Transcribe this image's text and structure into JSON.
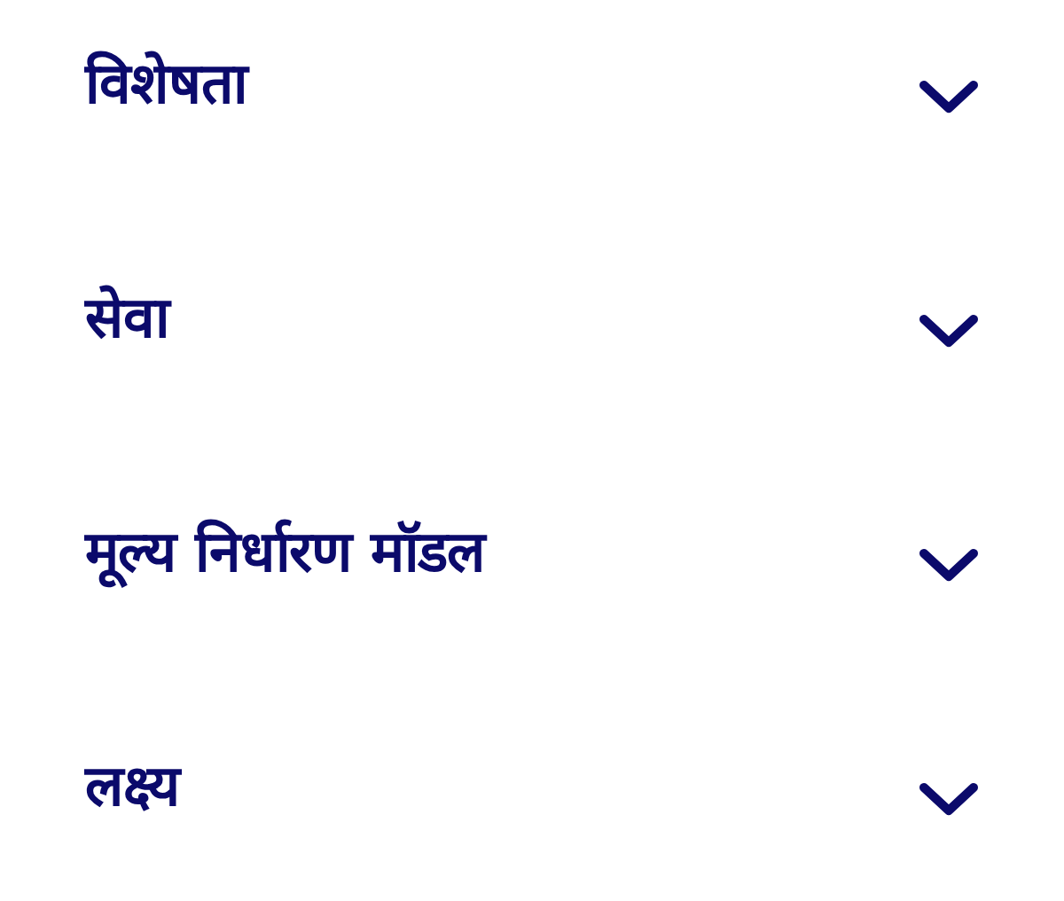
{
  "accordion": [
    {
      "title": "विशेषता",
      "expanded": false
    },
    {
      "title": "सेवा",
      "expanded": false
    },
    {
      "title": "मूल्य निर्धारण मॉडल",
      "expanded": false
    },
    {
      "title": "लक्ष्य",
      "expanded": false
    }
  ]
}
